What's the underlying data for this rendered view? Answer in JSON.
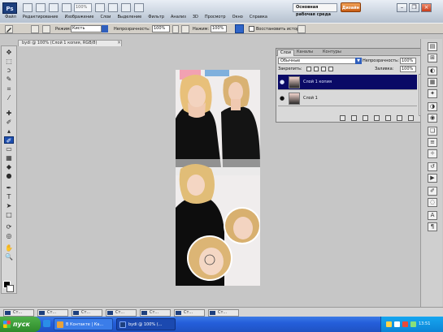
{
  "app": {
    "logo": "Ps",
    "zoom": "100%",
    "workspace": "Основная рабочая среда",
    "extra_button": "Дизайн"
  },
  "menu": [
    "Файл",
    "Редактирование",
    "Изображение",
    "Слои",
    "Выделение",
    "Фильтр",
    "Анализ",
    "3D",
    "Просмотр",
    "Окно",
    "Справка"
  ],
  "window_controls": {
    "minimize": "–",
    "restore": "❐",
    "close": "×"
  },
  "options": {
    "mode_label": "Режим:",
    "mode_value": "Кисть",
    "opacity_label": "Непрозрачность:",
    "opacity_value": "100%",
    "pressure_label": "Нажим:",
    "pressure_value": "100%",
    "history_label": "Восстановить историю"
  },
  "document_tab": {
    "title": "bydi @ 100% (Слой 1 копия, RGB/8)",
    "close": "×"
  },
  "layers_panel": {
    "tabs": [
      "Слои",
      "Каналы",
      "Контуры"
    ],
    "blend_mode": "Обычные",
    "blend_arrow": "▼",
    "opacity_label": "Непрозрачность:",
    "opacity_value": "100%",
    "lock_label": "Закрепить:",
    "fill_label": "Заливка:",
    "fill_value": "100%",
    "layers": [
      {
        "name": "Слой 1 копия",
        "eye": "●",
        "selected": true
      },
      {
        "name": "Слой 1",
        "eye": "●",
        "selected": false
      }
    ],
    "bottom_icons": [
      "link-icon",
      "fx-icon",
      "mask-icon",
      "adjustment-icon",
      "group-icon",
      "new-layer-icon",
      "trash-icon"
    ]
  },
  "tools": [
    {
      "name": "move-tool-icon",
      "glyph": "✥"
    },
    {
      "name": "marquee-tool-icon",
      "glyph": "⬚"
    },
    {
      "name": "lasso-tool-icon",
      "glyph": "ↄ"
    },
    {
      "name": "quick-select-tool-icon",
      "glyph": "✎"
    },
    {
      "name": "crop-tool-icon",
      "glyph": "⌗"
    },
    {
      "name": "eyedropper-tool-icon",
      "glyph": "⁄"
    },
    {
      "name": "healing-tool-icon",
      "glyph": "✚"
    },
    {
      "name": "brush-tool-icon",
      "glyph": "✐"
    },
    {
      "name": "stamp-tool-icon",
      "glyph": "▴"
    },
    {
      "name": "history-brush-tool-icon",
      "glyph": "✐"
    },
    {
      "name": "eraser-tool-icon",
      "glyph": "▭"
    },
    {
      "name": "gradient-tool-icon",
      "glyph": "▦"
    },
    {
      "name": "blur-tool-icon",
      "glyph": "◆"
    },
    {
      "name": "dodge-tool-icon",
      "glyph": "●"
    },
    {
      "name": "pen-tool-icon",
      "glyph": "✒"
    },
    {
      "name": "type-tool-icon",
      "glyph": "T"
    },
    {
      "name": "path-select-tool-icon",
      "glyph": "➤"
    },
    {
      "name": "shape-tool-icon",
      "glyph": "□"
    },
    {
      "name": "3d-rotate-tool-icon",
      "glyph": "⟳"
    },
    {
      "name": "3d-camera-tool-icon",
      "glyph": "◎"
    },
    {
      "name": "hand-tool-icon",
      "glyph": "✋"
    },
    {
      "name": "zoom-tool-icon",
      "glyph": "🔍"
    }
  ],
  "active_tool_index": 9,
  "dock_icons": [
    {
      "name": "histogram-icon",
      "glyph": "▤"
    },
    {
      "name": "navigator-icon",
      "glyph": "⊞"
    },
    {
      "name": "color-icon",
      "glyph": "◐"
    },
    {
      "name": "swatches-icon",
      "glyph": "▦"
    },
    {
      "name": "styles-icon",
      "glyph": "✦"
    },
    {
      "name": "adjustments-icon",
      "glyph": "◑"
    },
    {
      "name": "masks-icon",
      "glyph": "◉"
    },
    {
      "name": "layers-dock-icon",
      "glyph": "❏"
    },
    {
      "name": "channels-dock-icon",
      "glyph": "≡"
    },
    {
      "name": "paths-dock-icon",
      "glyph": "✧"
    },
    {
      "name": "history-dock-icon",
      "glyph": "↺"
    },
    {
      "name": "actions-dock-icon",
      "glyph": "▶"
    },
    {
      "name": "brush-dock-icon",
      "glyph": "✐"
    },
    {
      "name": "clone-dock-icon",
      "glyph": "◌"
    },
    {
      "name": "character-dock-icon",
      "glyph": "A"
    },
    {
      "name": "paragraph-dock-icon",
      "glyph": "¶"
    }
  ],
  "minimized_docs": [
    "Ст...",
    "Ст...",
    "Ст...",
    "Ст...",
    "Ст...",
    "Ст...",
    "Ст..."
  ],
  "taskbar": {
    "start": "пуск",
    "buttons": [
      {
        "label": "В Контакте | Ка...",
        "icon_color": "#e8a23a"
      },
      {
        "label": "bydi @ 100% (...",
        "icon_color": "#1d3f7d"
      }
    ],
    "clock": "13:51"
  },
  "colors": {
    "foreground": "#000000",
    "background": "#ffffff",
    "selected_layer": "#0a0a66",
    "accent": "#2f65c8"
  }
}
